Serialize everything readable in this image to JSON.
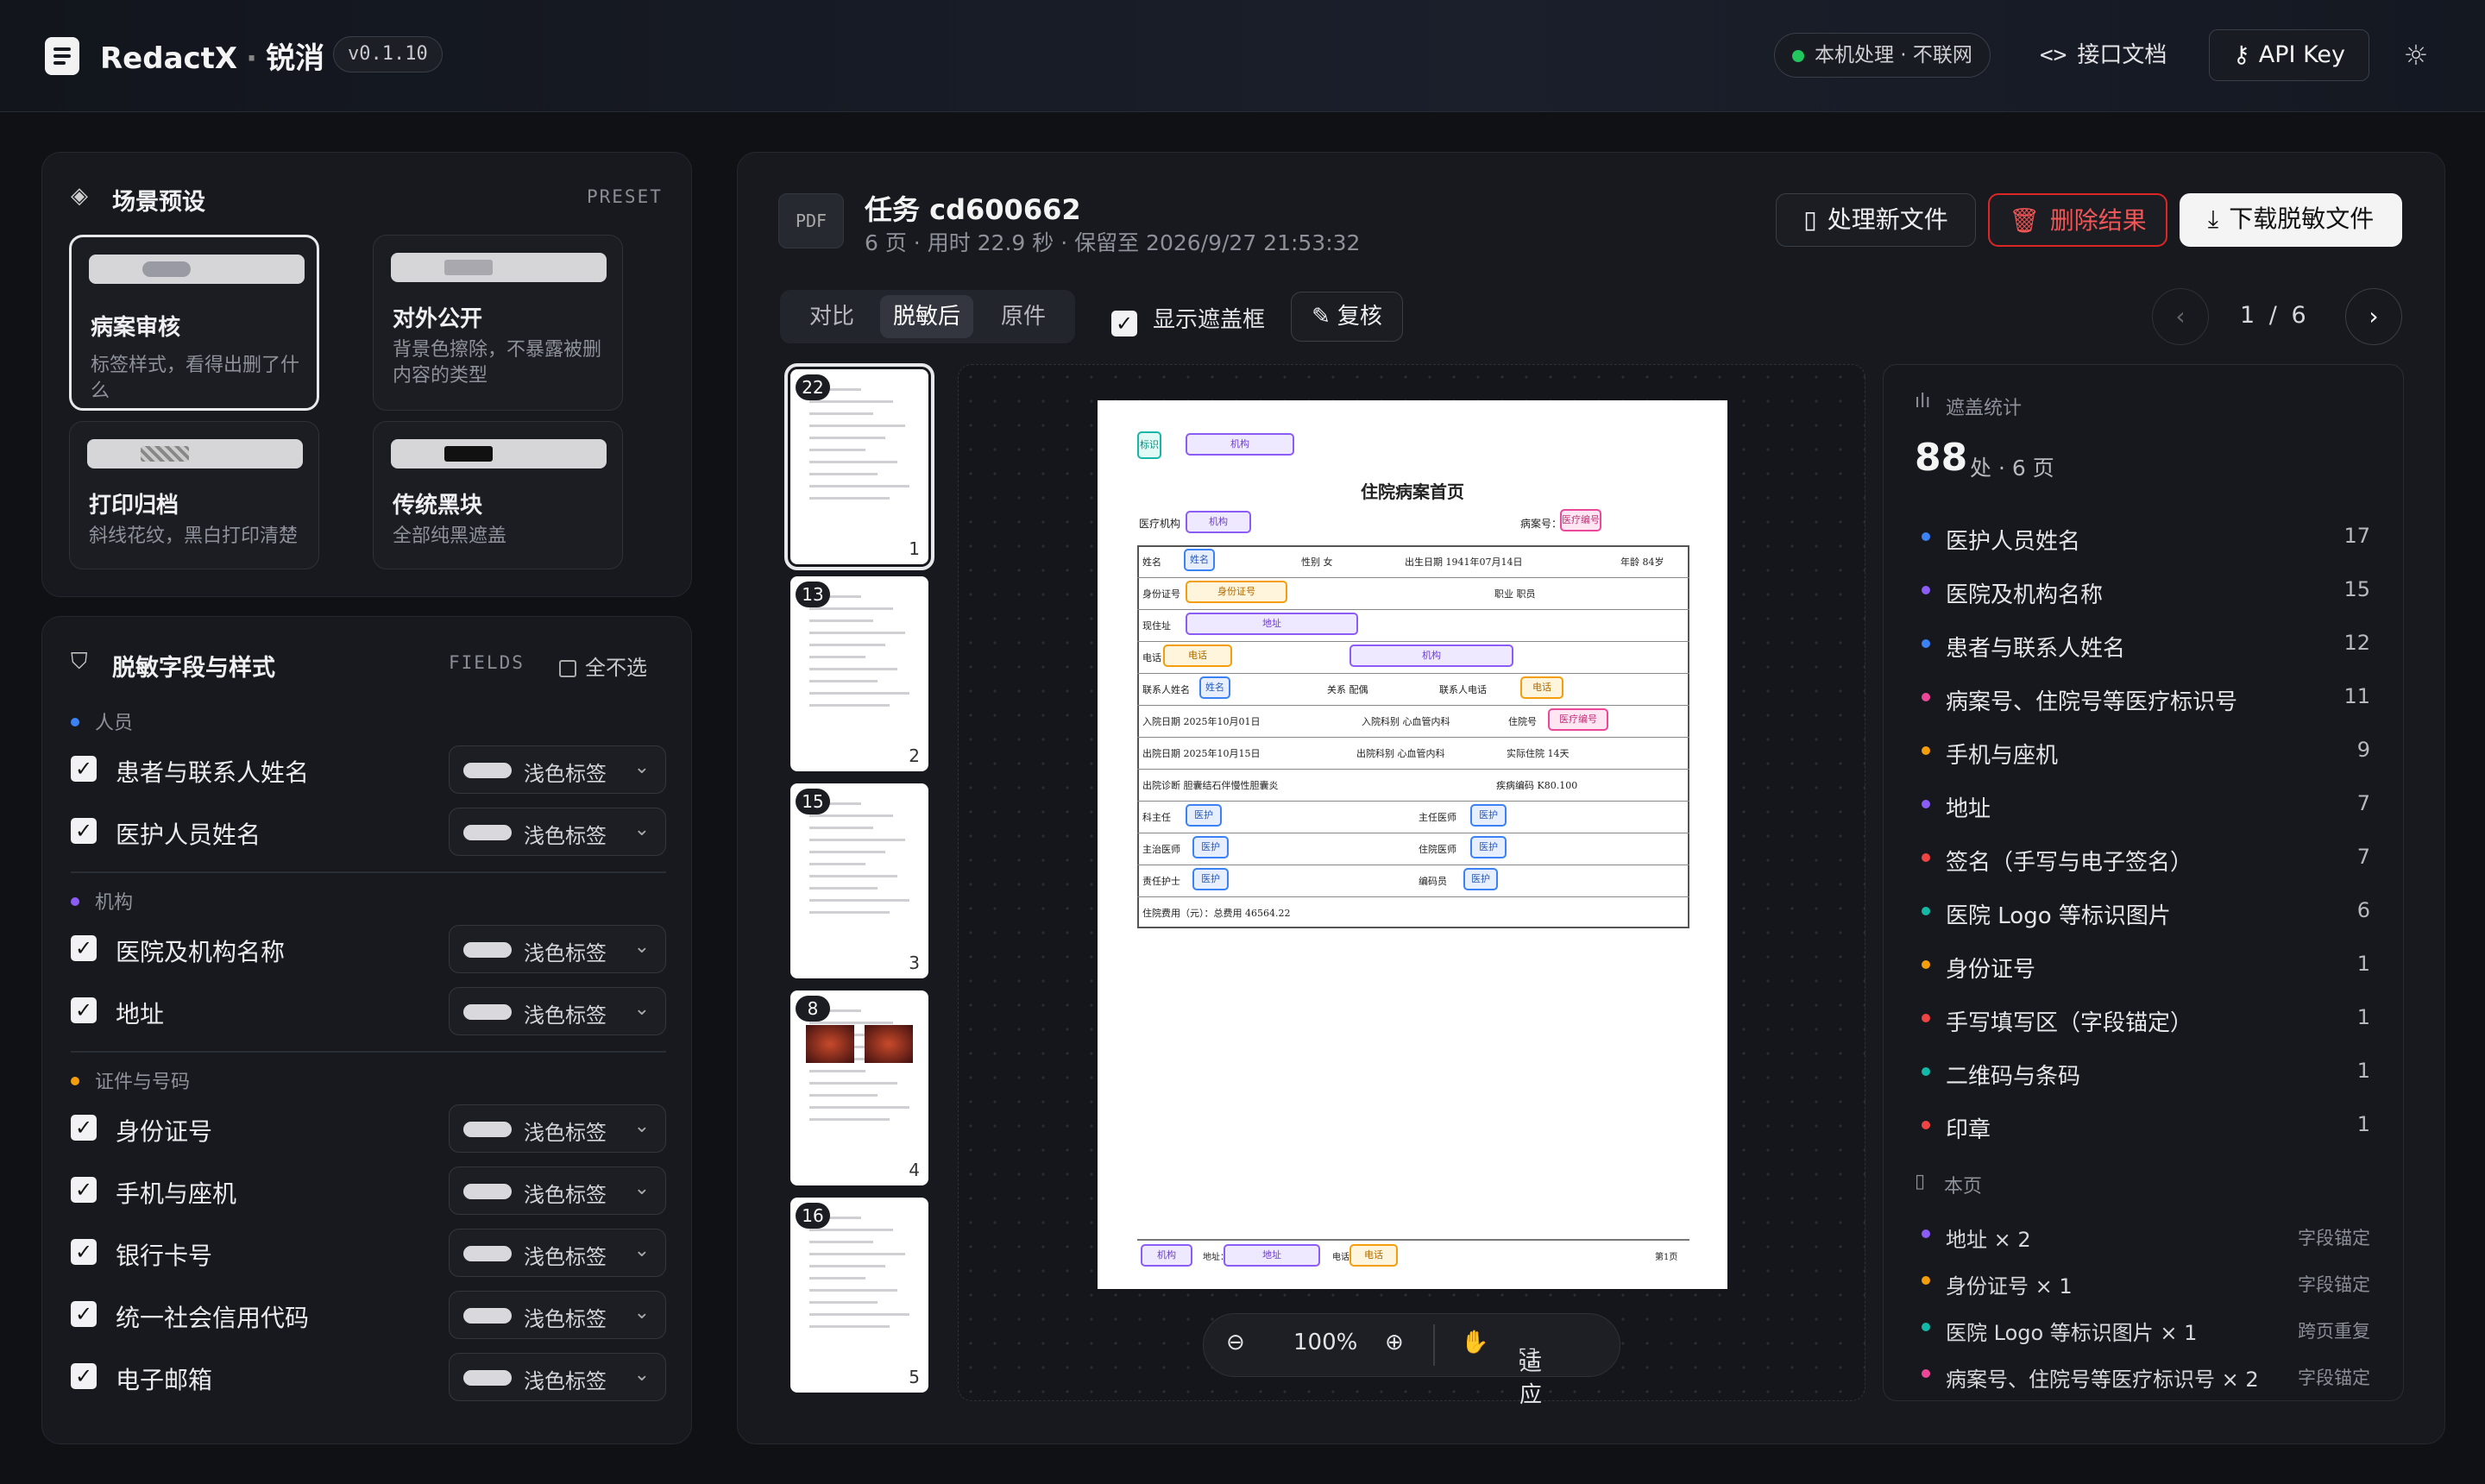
{
  "header": {
    "brand": "RedactX",
    "sep": "·",
    "brand_cn": "锐消",
    "version": "v0.1.10",
    "local_status": "本机处理 · 不联网",
    "docs_label": "接口文档",
    "apikey_label": "API Key"
  },
  "preset": {
    "title": "场景预设",
    "tag": "PRESET",
    "cards": [
      {
        "title": "病案审核",
        "desc": "标签样式，看得出删了什么"
      },
      {
        "title": "对外公开",
        "desc": "背景色擦除，不暴露被删内容的类型"
      },
      {
        "title": "打印归档",
        "desc": "斜线花纹，黑白打印清楚"
      },
      {
        "title": "传统黑块",
        "desc": "全部纯黑遮盖"
      }
    ]
  },
  "fields": {
    "title": "脱敏字段与样式",
    "tag": "FIELDS",
    "select_none": "全不选",
    "style_label": "浅色标签",
    "groups": [
      {
        "name": "人员",
        "color": "#3b82f6",
        "items": [
          "患者与联系人姓名",
          "医护人员姓名"
        ]
      },
      {
        "name": "机构",
        "color": "#8b5cf6",
        "items": [
          "医院及机构名称",
          "地址"
        ]
      },
      {
        "name": "证件与号码",
        "color": "#f59e0b",
        "items": [
          "身份证号",
          "手机与座机",
          "银行卡号",
          "统一社会信用代码",
          "电子邮箱"
        ]
      }
    ]
  },
  "task": {
    "type": "PDF",
    "title": "任务 cd600662",
    "meta": "6 页 · 用时 22.9 秒 · 保留至 2026/9/27 21:53:32",
    "btn_new": "处理新文件",
    "btn_delete": "删除结果",
    "btn_download": "下载脱敏文件"
  },
  "view": {
    "tabs": [
      "对比",
      "脱敏后",
      "原件"
    ],
    "active_tab": "脱敏后",
    "show_mask": "显示遮盖框",
    "review": "复核",
    "page_current": "1",
    "page_sep": "/",
    "page_total": "6",
    "zoom": "100%",
    "fit": "适应"
  },
  "thumbs": [
    {
      "badge": "22",
      "page": "1"
    },
    {
      "badge": "13",
      "page": "2"
    },
    {
      "badge": "15",
      "page": "3"
    },
    {
      "badge": "8",
      "page": "4"
    },
    {
      "badge": "16",
      "page": "5"
    }
  ],
  "doc": {
    "title": "住院病案首页",
    "tags": {
      "mark": "标识",
      "org": "机构",
      "name": "姓名",
      "id": "身份证号",
      "addr": "地址",
      "phone": "电话",
      "record": "医疗编号",
      "staff": "医护"
    },
    "lines": {
      "org_label": "医疗机构",
      "record_label": "病案号：",
      "name_label": "姓名",
      "sex": "性别  女",
      "birth": "出生日期  1941年07月14日",
      "age": "年龄  84岁",
      "id_label": "身份证号",
      "job": "职业  职员",
      "addr_label": "现住址",
      "phone_label": "电话",
      "contact_label": "联系人姓名",
      "relation": "关系  配偶",
      "contact_phone": "联系人电话",
      "admit": "入院日期  2025年10月01日",
      "admit_dept": "入院科别  心血管内科",
      "bed_label": "住院号",
      "discharge": "出院日期  2025年10月15日",
      "dis_dept": "出院科别  心血管内科",
      "days": "实际住院  14天",
      "diagnosis": "出院诊断  胆囊结石伴慢性胆囊炎",
      "icd": "疾病编码  K80.100",
      "dept_head": "科主任",
      "chief": "主任医师",
      "attending": "主治医师",
      "resident": "住院医师",
      "nurse": "责任护士",
      "coder": "编码员",
      "cost": "住院费用（元）：总费用  46564.22",
      "foot_addr": "地址：",
      "foot_phone": "电话：",
      "foot_page": "第1页"
    }
  },
  "stats": {
    "title": "遮盖统计",
    "total": "88",
    "unit": "处 · 6 页",
    "items": [
      {
        "name": "医护人员姓名",
        "count": "17",
        "color": "#3b82f6"
      },
      {
        "name": "医院及机构名称",
        "count": "15",
        "color": "#8b5cf6"
      },
      {
        "name": "患者与联系人姓名",
        "count": "12",
        "color": "#3b82f6"
      },
      {
        "name": "病案号、住院号等医疗标识号",
        "count": "11",
        "color": "#ec4899"
      },
      {
        "name": "手机与座机",
        "count": "9",
        "color": "#f59e0b"
      },
      {
        "name": "地址",
        "count": "7",
        "color": "#8b5cf6"
      },
      {
        "name": "签名（手写与电子签名）",
        "count": "7",
        "color": "#ef4444"
      },
      {
        "name": "医院 Logo 等标识图片",
        "count": "6",
        "color": "#14b8a6"
      },
      {
        "name": "身份证号",
        "count": "1",
        "color": "#f59e0b"
      },
      {
        "name": "手写填写区（字段锚定）",
        "count": "1",
        "color": "#ef4444"
      },
      {
        "name": "二维码与条码",
        "count": "1",
        "color": "#14b8a6"
      },
      {
        "name": "印章",
        "count": "1",
        "color": "#ef4444"
      }
    ],
    "page_title": "本页",
    "page_items": [
      {
        "name": "地址 × 2",
        "method": "字段锚定",
        "color": "#8b5cf6"
      },
      {
        "name": "身份证号 × 1",
        "method": "字段锚定",
        "color": "#f59e0b"
      },
      {
        "name": "医院 Logo 等标识图片 × 1",
        "method": "跨页重复",
        "color": "#14b8a6"
      },
      {
        "name": "病案号、住院号等医疗标识号 × 2",
        "method": "字段锚定",
        "color": "#ec4899"
      }
    ]
  }
}
